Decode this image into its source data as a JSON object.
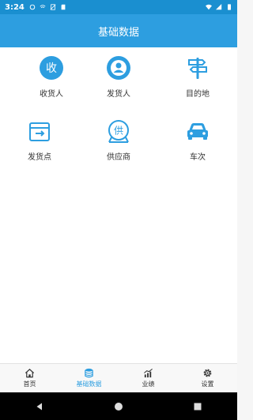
{
  "status_bar": {
    "time": "3:24"
  },
  "header": {
    "title": "基础数据"
  },
  "tiles": [
    {
      "label": "收货人",
      "glyph": "收"
    },
    {
      "label": "发货人"
    },
    {
      "label": "目的地"
    },
    {
      "label": "发货点"
    },
    {
      "label": "供应商",
      "glyph": "供"
    },
    {
      "label": "车次"
    }
  ],
  "tabs": [
    {
      "label": "首页"
    },
    {
      "label": "基础数据"
    },
    {
      "label": "业绩"
    },
    {
      "label": "设置"
    }
  ],
  "colors": {
    "accent": "#2d9ee0",
    "status_bar": "#1a8fd0"
  }
}
